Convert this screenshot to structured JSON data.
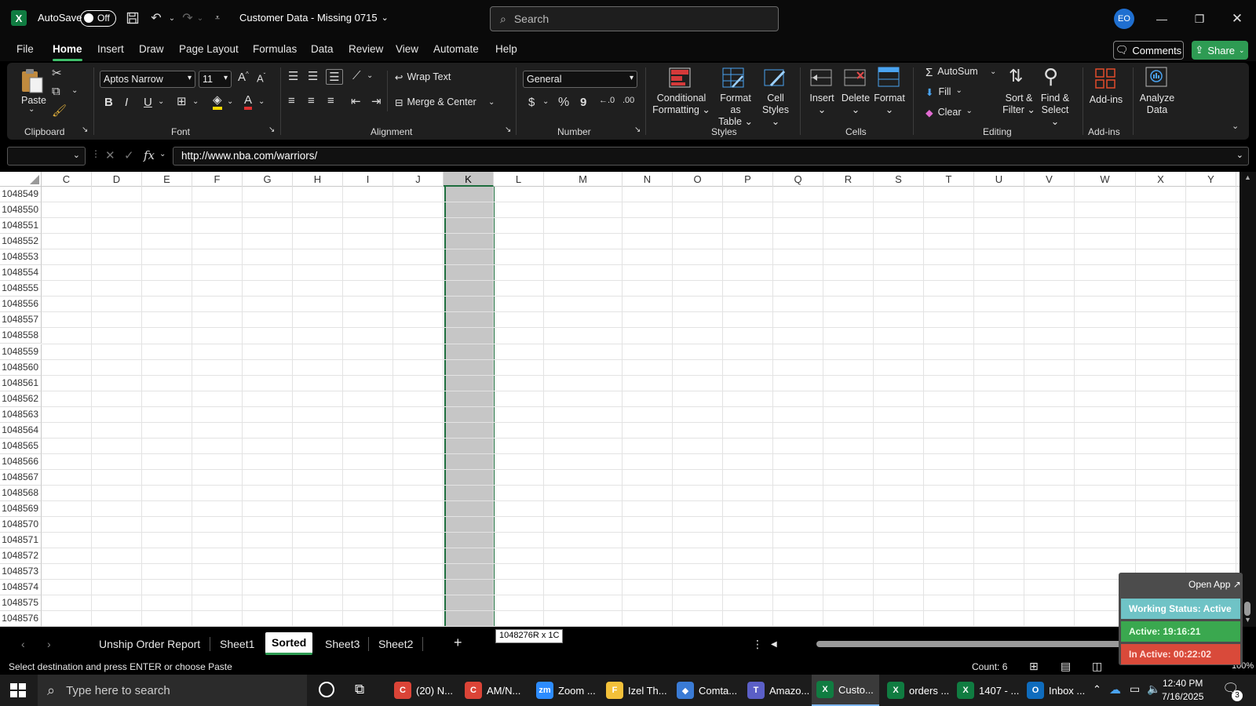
{
  "titlebar": {
    "autosave_label": "AutoSave",
    "autosave_state": "Off",
    "doc_title": "Customer Data - Missing 0715",
    "search_placeholder": "Search",
    "avatar_initials": "EO"
  },
  "menu": {
    "tabs": [
      "File",
      "Home",
      "Insert",
      "Draw",
      "Page Layout",
      "Formulas",
      "Data",
      "Review",
      "View",
      "Automate",
      "Help"
    ],
    "active_tab": "Home",
    "comments_label": "Comments",
    "share_label": "Share"
  },
  "ribbon": {
    "clipboard": {
      "label": "Clipboard",
      "paste": "Paste"
    },
    "font": {
      "label": "Font",
      "family": "Aptos Narrow",
      "size": "11",
      "bold": "B",
      "italic": "I",
      "underline": "U"
    },
    "alignment": {
      "label": "Alignment",
      "wrap_text": "Wrap Text",
      "merge_center": "Merge & Center"
    },
    "number": {
      "label": "Number",
      "format": "General",
      "currency": "$",
      "percent": "%",
      "comma": "9"
    },
    "styles": {
      "label": "Styles",
      "conditional_line1": "Conditional",
      "conditional_line2": "Formatting",
      "format_table_line1": "Format as",
      "format_table_line2": "Table",
      "cell_styles_line1": "Cell",
      "cell_styles_line2": "Styles"
    },
    "cells": {
      "label": "Cells",
      "insert": "Insert",
      "delete": "Delete",
      "format": "Format"
    },
    "editing": {
      "label": "Editing",
      "autosum": "AutoSum",
      "fill": "Fill",
      "clear": "Clear",
      "sort_line1": "Sort &",
      "sort_line2": "Filter",
      "find_line1": "Find &",
      "find_line2": "Select"
    },
    "addins": {
      "label": "Add-ins",
      "addins_btn": "Add-ins",
      "analyze_line1": "Analyze",
      "analyze_line2": "Data"
    }
  },
  "formula_bar": {
    "fx": "fx",
    "value": "http://www.nba.com/warriors/"
  },
  "grid": {
    "columns": [
      "C",
      "D",
      "E",
      "F",
      "G",
      "H",
      "I",
      "J",
      "K",
      "L",
      "M",
      "N",
      "O",
      "P",
      "Q",
      "R",
      "S",
      "T",
      "U",
      "V",
      "W",
      "X",
      "Y"
    ],
    "selected_column": "K",
    "rows": [
      "1048549",
      "1048550",
      "1048551",
      "1048552",
      "1048553",
      "1048554",
      "1048555",
      "1048556",
      "1048557",
      "1048558",
      "1048559",
      "1048560",
      "1048561",
      "1048562",
      "1048563",
      "1048564",
      "1048565",
      "1048566",
      "1048567",
      "1048568",
      "1048569",
      "1048570",
      "1048571",
      "1048572",
      "1048573",
      "1048574",
      "1048575",
      "1048576"
    ]
  },
  "sheets": {
    "tabs": [
      "Unship Order Report",
      "Sheet1",
      "Sorted",
      "Sheet3",
      "Sheet2"
    ],
    "active": "Sorted",
    "selection_tooltip": "1048276R x 1C"
  },
  "statusbar": {
    "message": "Select destination and press ENTER or choose Paste",
    "count": "Count: 6",
    "zoom": "100%"
  },
  "tracker": {
    "open_app": "Open App ↗",
    "working_status": "Working Status: Active",
    "active": "Active: 19:16:21",
    "inactive": "In Active: 00:22:02"
  },
  "taskbar": {
    "search_placeholder": "Type here to search",
    "apps": [
      {
        "label": "(20) N...",
        "icon": "C",
        "color": "#db4437"
      },
      {
        "label": "AM/N...",
        "icon": "C",
        "color": "#db4437"
      },
      {
        "label": "Zoom ...",
        "icon": "zm",
        "color": "#2d8cff"
      },
      {
        "label": "Izel Th...",
        "icon": "F",
        "color": "#f3c13a"
      },
      {
        "label": "Comta...",
        "icon": "◆",
        "color": "#3a7bd5"
      },
      {
        "label": "Amazo...",
        "icon": "T",
        "color": "#5b5fc7"
      },
      {
        "label": "Custo...",
        "icon": "X",
        "color": "#107c41"
      },
      {
        "label": "orders ...",
        "icon": "X",
        "color": "#107c41"
      },
      {
        "label": "1407 - ...",
        "icon": "X",
        "color": "#107c41"
      },
      {
        "label": "Inbox ...",
        "icon": "O",
        "color": "#0f6cbd"
      }
    ],
    "time": "12:40 PM",
    "date": "7/16/2025",
    "notifications": "3"
  }
}
